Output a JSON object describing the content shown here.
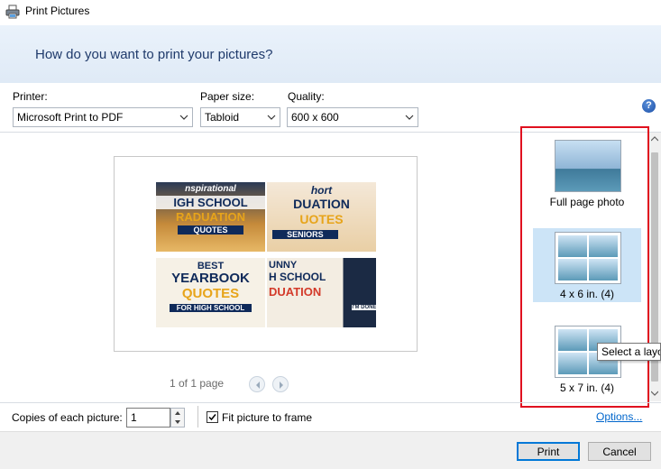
{
  "window": {
    "title": "Print Pictures",
    "icon": "printer-icon"
  },
  "header": {
    "heading": "How do you want to print your pictures?"
  },
  "printer": {
    "label": "Printer:",
    "value": "Microsoft Print to PDF"
  },
  "paper_size": {
    "label": "Paper size:",
    "value": "Tabloid"
  },
  "quality": {
    "label": "Quality:",
    "value": "600 x 600"
  },
  "help": {
    "glyph": "?"
  },
  "preview": {
    "thumbnails": [
      {
        "lines": [
          "nspirational",
          "IGH SCHOOL",
          "RADUATION",
          "QUOTES"
        ]
      },
      {
        "lines": [
          "hort",
          "DUATION",
          "UOTES",
          "SENIORS"
        ]
      },
      {
        "lines": [
          "BEST",
          "YEARBOOK",
          "QUOTES",
          "FOR HIGH SCHOOL"
        ]
      },
      {
        "lines": [
          "UNNY",
          "H SCHOOL",
          "DUATION",
          "I'M DONE"
        ]
      }
    ],
    "pager_text": "1 of 1 page"
  },
  "layouts": [
    {
      "label": "Full page photo",
      "selected": false
    },
    {
      "label": "4 x 6 in. (4)",
      "selected": true
    },
    {
      "label": "5 x 7 in. (4)",
      "selected": false
    }
  ],
  "tooltip": "Select a layout",
  "copies": {
    "label": "Copies of each picture:",
    "value": "1"
  },
  "fit": {
    "label": "Fit picture to frame",
    "checked": true
  },
  "options_link": "Options...",
  "buttons": {
    "print": "Print",
    "cancel": "Cancel"
  },
  "colors": {
    "accent": "#0078d7",
    "highlight": "#e0101f",
    "heading": "#1f3a6b"
  }
}
